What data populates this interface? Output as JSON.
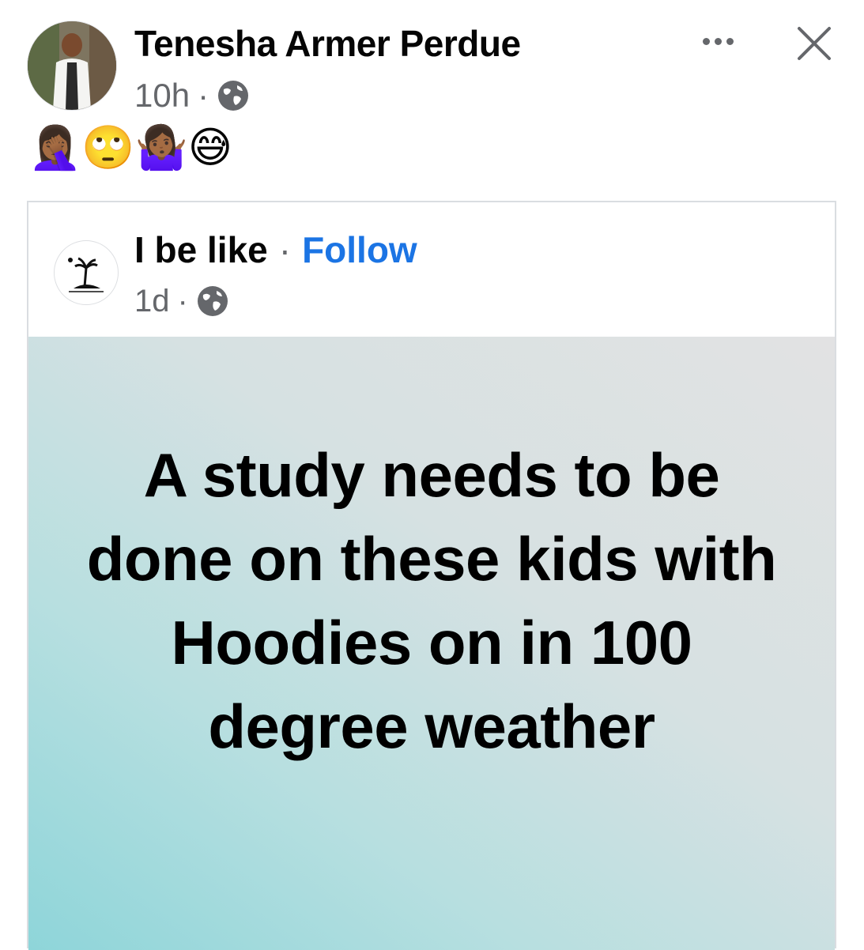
{
  "post": {
    "author": "Tenesha Armer Perdue",
    "time": "10h",
    "sep": "·",
    "caption": "🤦🏾‍♀️🙄🤷🏾‍♀️😅",
    "audience_icon": "globe-icon",
    "more_icon": "more-horizontal-icon",
    "close_icon": "close-icon"
  },
  "shared_post": {
    "page_name": "I be like",
    "sep": "·",
    "follow_label": "Follow",
    "time": "1d",
    "audience_icon": "globe-icon",
    "quote": "A study needs to be done on these kids with Hoodies on in 100 degree weather"
  },
  "colors": {
    "link": "#1b74e4",
    "meta": "#65676b",
    "quote_gradient_start": "#8ed5d9",
    "quote_gradient_end": "#e2e2e3"
  }
}
